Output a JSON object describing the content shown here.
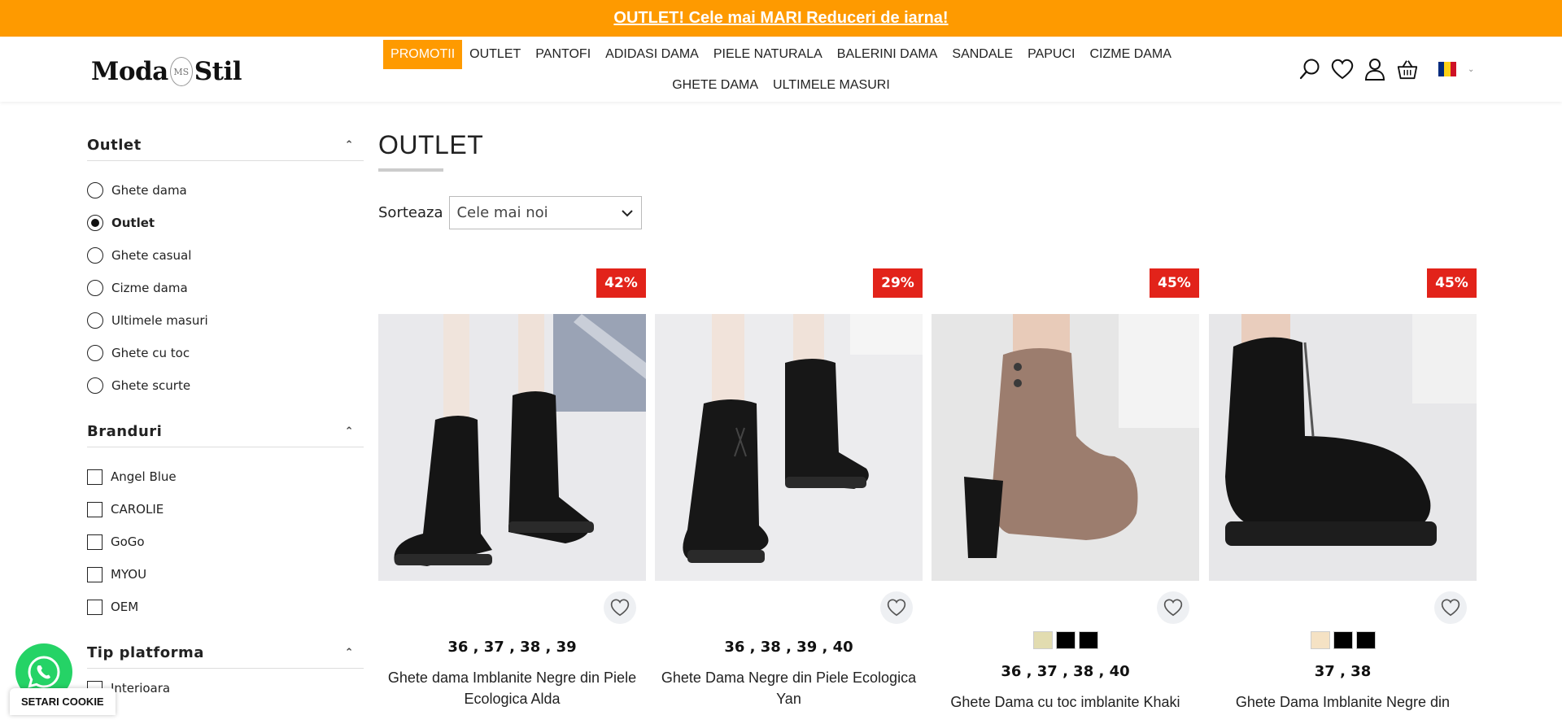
{
  "promo_bar": {
    "text": "OUTLET! Cele mai MARI Reduceri de iarna!"
  },
  "logo": {
    "left": "Moda",
    "mark": "MS",
    "right": "Stil"
  },
  "nav": {
    "row1": [
      "PROMOTII",
      "OUTLET",
      "PANTOFI",
      "ADIDASI DAMA",
      "PIELE NATURALA",
      "BALERINI DAMA",
      "SANDALE",
      "PAPUCI",
      "CIZME DAMA"
    ],
    "row2": [
      "GHETE DAMA",
      "ULTIMELE MASURI"
    ]
  },
  "header_icons": [
    "search-icon",
    "heart-icon",
    "user-icon",
    "basket-icon",
    "romania-flag-icon"
  ],
  "colors": {
    "accent": "#fe9a00",
    "badge": "#e2231a",
    "flag_blue": "#002b7f",
    "flag_yellow": "#fcd116",
    "flag_red": "#ce1126"
  },
  "sidebar": {
    "outlet": {
      "title": "Outlet",
      "options": [
        "Ghete dama",
        "Outlet",
        "Ghete casual",
        "Cizme dama",
        "Ultimele masuri",
        "Ghete cu toc",
        "Ghete scurte"
      ],
      "selected": "Outlet"
    },
    "branduri": {
      "title": "Branduri",
      "options": [
        "Angel Blue",
        "CAROLIE",
        "GoGo",
        "MYOU",
        "OEM"
      ]
    },
    "platforma": {
      "title": "Tip platforma",
      "options": [
        "Interioara"
      ]
    }
  },
  "main": {
    "title": "OUTLET",
    "sort_label": "Sorteaza",
    "sort_value": "Cele mai noi"
  },
  "products": [
    {
      "discount": "42%",
      "sizes": "36 , 37 , 38 , 39",
      "name": "Ghete dama Imblanite Negre din Piele Ecologica Alda",
      "swatches": []
    },
    {
      "discount": "29%",
      "sizes": "36 , 38 , 39 , 40",
      "name": "Ghete Dama Negre din Piele Ecologica Yan",
      "swatches": []
    },
    {
      "discount": "45%",
      "sizes": "36 , 37 , 38 , 40",
      "name": "Ghete Dama cu toc imblanite Khaki",
      "swatches": [
        "#e2dcb0",
        "#000000",
        "#000000"
      ]
    },
    {
      "discount": "45%",
      "sizes": "37 , 38",
      "name": "Ghete Dama Imblanite Negre din",
      "swatches": [
        "#f5e2c4",
        "#000000",
        "#000000"
      ]
    }
  ],
  "cookie_button": "SETARI COOKIE"
}
